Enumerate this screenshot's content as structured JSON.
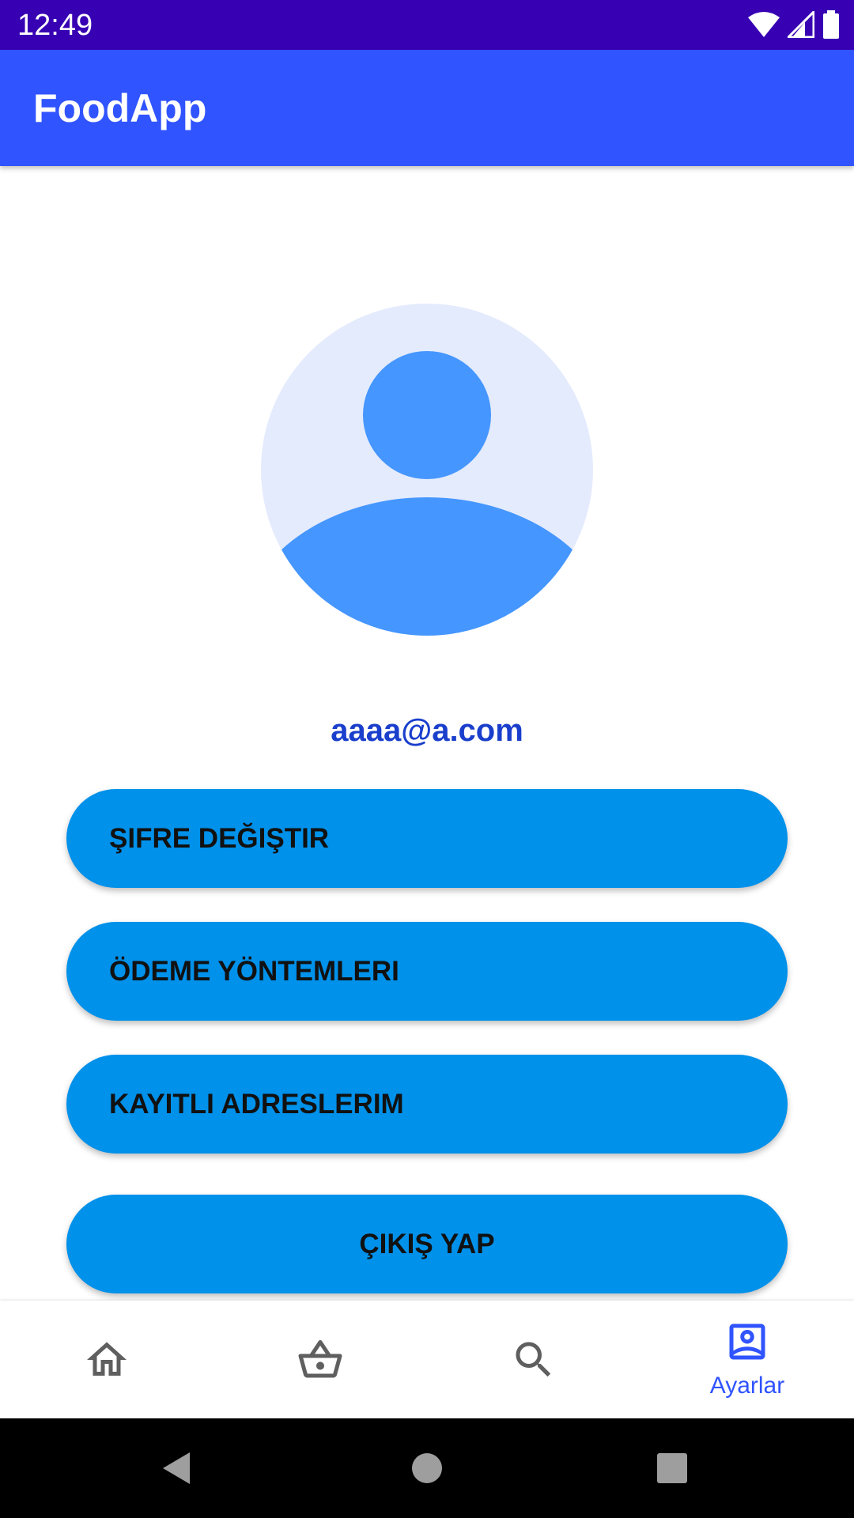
{
  "status_bar": {
    "time": "12:49",
    "background": "#3700B3",
    "icons": [
      "wifi-icon",
      "cell-signal-icon",
      "battery-icon"
    ]
  },
  "app_bar": {
    "title": "FoodApp",
    "background": "#3054FF"
  },
  "profile": {
    "avatar_icon": "account-circle-icon",
    "email": "aaaa@a.com"
  },
  "menu": {
    "change_password": "ŞIFRE DEĞIŞTIR",
    "payment_methods": "ÖDEME YÖNTEMLERI",
    "saved_addresses": "KAYITLI ADRESLERIM",
    "logout": "ÇIKIŞ YAP",
    "button_color": "#0091EA"
  },
  "bottom_nav": {
    "items": [
      {
        "icon": "home-icon",
        "label": "",
        "selected": false
      },
      {
        "icon": "basket-icon",
        "label": "",
        "selected": false
      },
      {
        "icon": "search-icon",
        "label": "",
        "selected": false
      },
      {
        "icon": "account-box-icon",
        "label": "Ayarlar",
        "selected": true
      }
    ],
    "active_color": "#3054FF",
    "inactive_color": "#5F5F5F"
  },
  "system_nav": {
    "icons": [
      "back-icon",
      "home-circle-icon",
      "recents-icon"
    ]
  }
}
